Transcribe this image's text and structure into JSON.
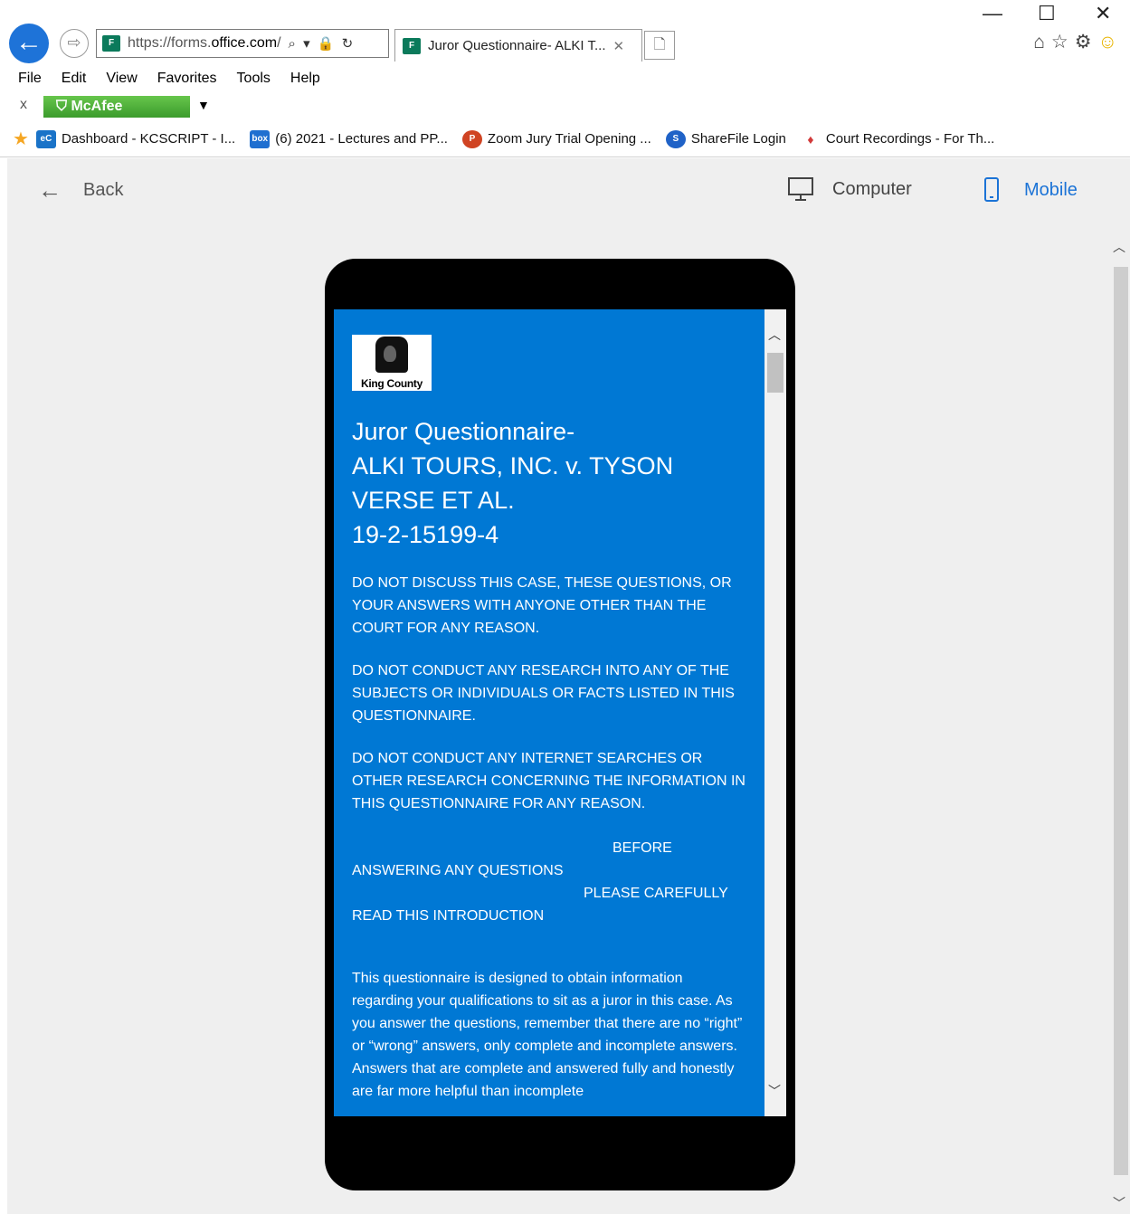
{
  "browser": {
    "url_prefix": "https://forms.",
    "url_domain": "office.com",
    "url_suffix": "/",
    "address_icons": "⌕ ▾ 🔒 ↻",
    "tab_title": "Juror Questionnaire- ALKI T...",
    "tab_close": "✕",
    "window_controls": {
      "minimize": "—",
      "maximize": "☐",
      "close": "✕"
    },
    "favicon_label": "F"
  },
  "menu": {
    "items": [
      "File",
      "Edit",
      "View",
      "Favorites",
      "Tools",
      "Help"
    ]
  },
  "mcafee": {
    "close": "x",
    "label": "McAfee",
    "arrow": "▼"
  },
  "favorites": [
    {
      "icon_text": "eC",
      "icon_color": "#1a73c8",
      "label": "Dashboard - KCSCRIPT - I..."
    },
    {
      "icon_text": "box",
      "icon_color": "#1f6fd0",
      "label": "(6) 2021 - Lectures and PP..."
    },
    {
      "icon_text": "P",
      "icon_color": "#d04423",
      "label": "Zoom Jury Trial Opening ..."
    },
    {
      "icon_text": "S",
      "icon_color": "#1f62c7",
      "label": "ShareFile Login"
    },
    {
      "icon_text": "♦",
      "icon_color": "#d23a3a",
      "label": "Court Recordings - For Th..."
    }
  ],
  "preview_nav": {
    "back": "Back",
    "computer": "Computer",
    "mobile": "Mobile"
  },
  "form": {
    "logo_text": "King County",
    "title_lines": [
      "Juror Questionnaire-",
      "ALKI TOURS, INC. v. TYSON",
      "VERSE ET AL.",
      "19-2-15199-4"
    ],
    "paragraphs": [
      "DO NOT DISCUSS THIS CASE, THESE QUESTIONS, OR YOUR ANSWERS WITH ANYONE OTHER THAN THE COURT FOR ANY REASON.",
      "DO NOT CONDUCT ANY RESEARCH INTO ANY OF THE SUBJECTS OR INDIVIDUALS OR FACTS LISTED IN THIS QUESTIONNAIRE.",
      "DO NOT CONDUCT ANY INTERNET SEARCHES OR OTHER RESEARCH CONCERNING THE INFORMATION IN THIS QUESTIONNAIRE FOR ANY REASON."
    ],
    "intro_lines": [
      "BEFORE",
      "ANSWERING ANY QUESTIONS",
      "PLEASE CAREFULLY",
      "READ THIS INTRODUCTION"
    ],
    "body_text": "This questionnaire is designed to obtain information regarding your qualifications to sit as a juror in this case. As you answer the questions, remember that there are no “right” or “wrong” answers, only complete and incomplete answers.  Answers that are complete and answered fully and honestly are far more helpful than incomplete"
  },
  "colors": {
    "form_bg": "#0078d4",
    "mobile_accent": "#1b73d6",
    "phone_frame": "#000000",
    "preview_bg": "#efefef"
  }
}
